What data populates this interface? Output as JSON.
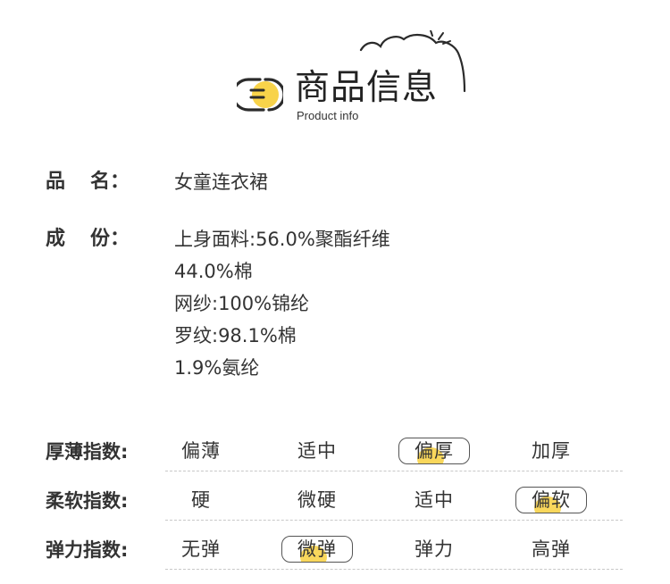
{
  "header": {
    "title": "商品信息",
    "subtitle": "Product info"
  },
  "info": {
    "name_label": "品名",
    "name_value": "女童连衣裙",
    "composition_label": "成份",
    "composition_lines": [
      "上身面料:56.0%聚酯纤维",
      "44.0%棉",
      "网纱:100%锦纶",
      "罗纹:98.1%棉",
      "1.9%氨纶"
    ]
  },
  "scales": [
    {
      "label": "厚薄指数:",
      "options": [
        "偏薄",
        "适中",
        "偏厚",
        "加厚"
      ],
      "selected": "偏厚"
    },
    {
      "label": "柔软指数:",
      "options": [
        "硬",
        "微硬",
        "适中",
        "偏软"
      ],
      "selected": "偏软"
    },
    {
      "label": "弹力指数:",
      "options": [
        "无弹",
        "微弹",
        "弹力",
        "高弹"
      ],
      "selected": "微弹"
    }
  ],
  "colors": {
    "accent_yellow": "#f8d34a",
    "text": "#333333",
    "dash": "#c8c8c8"
  }
}
